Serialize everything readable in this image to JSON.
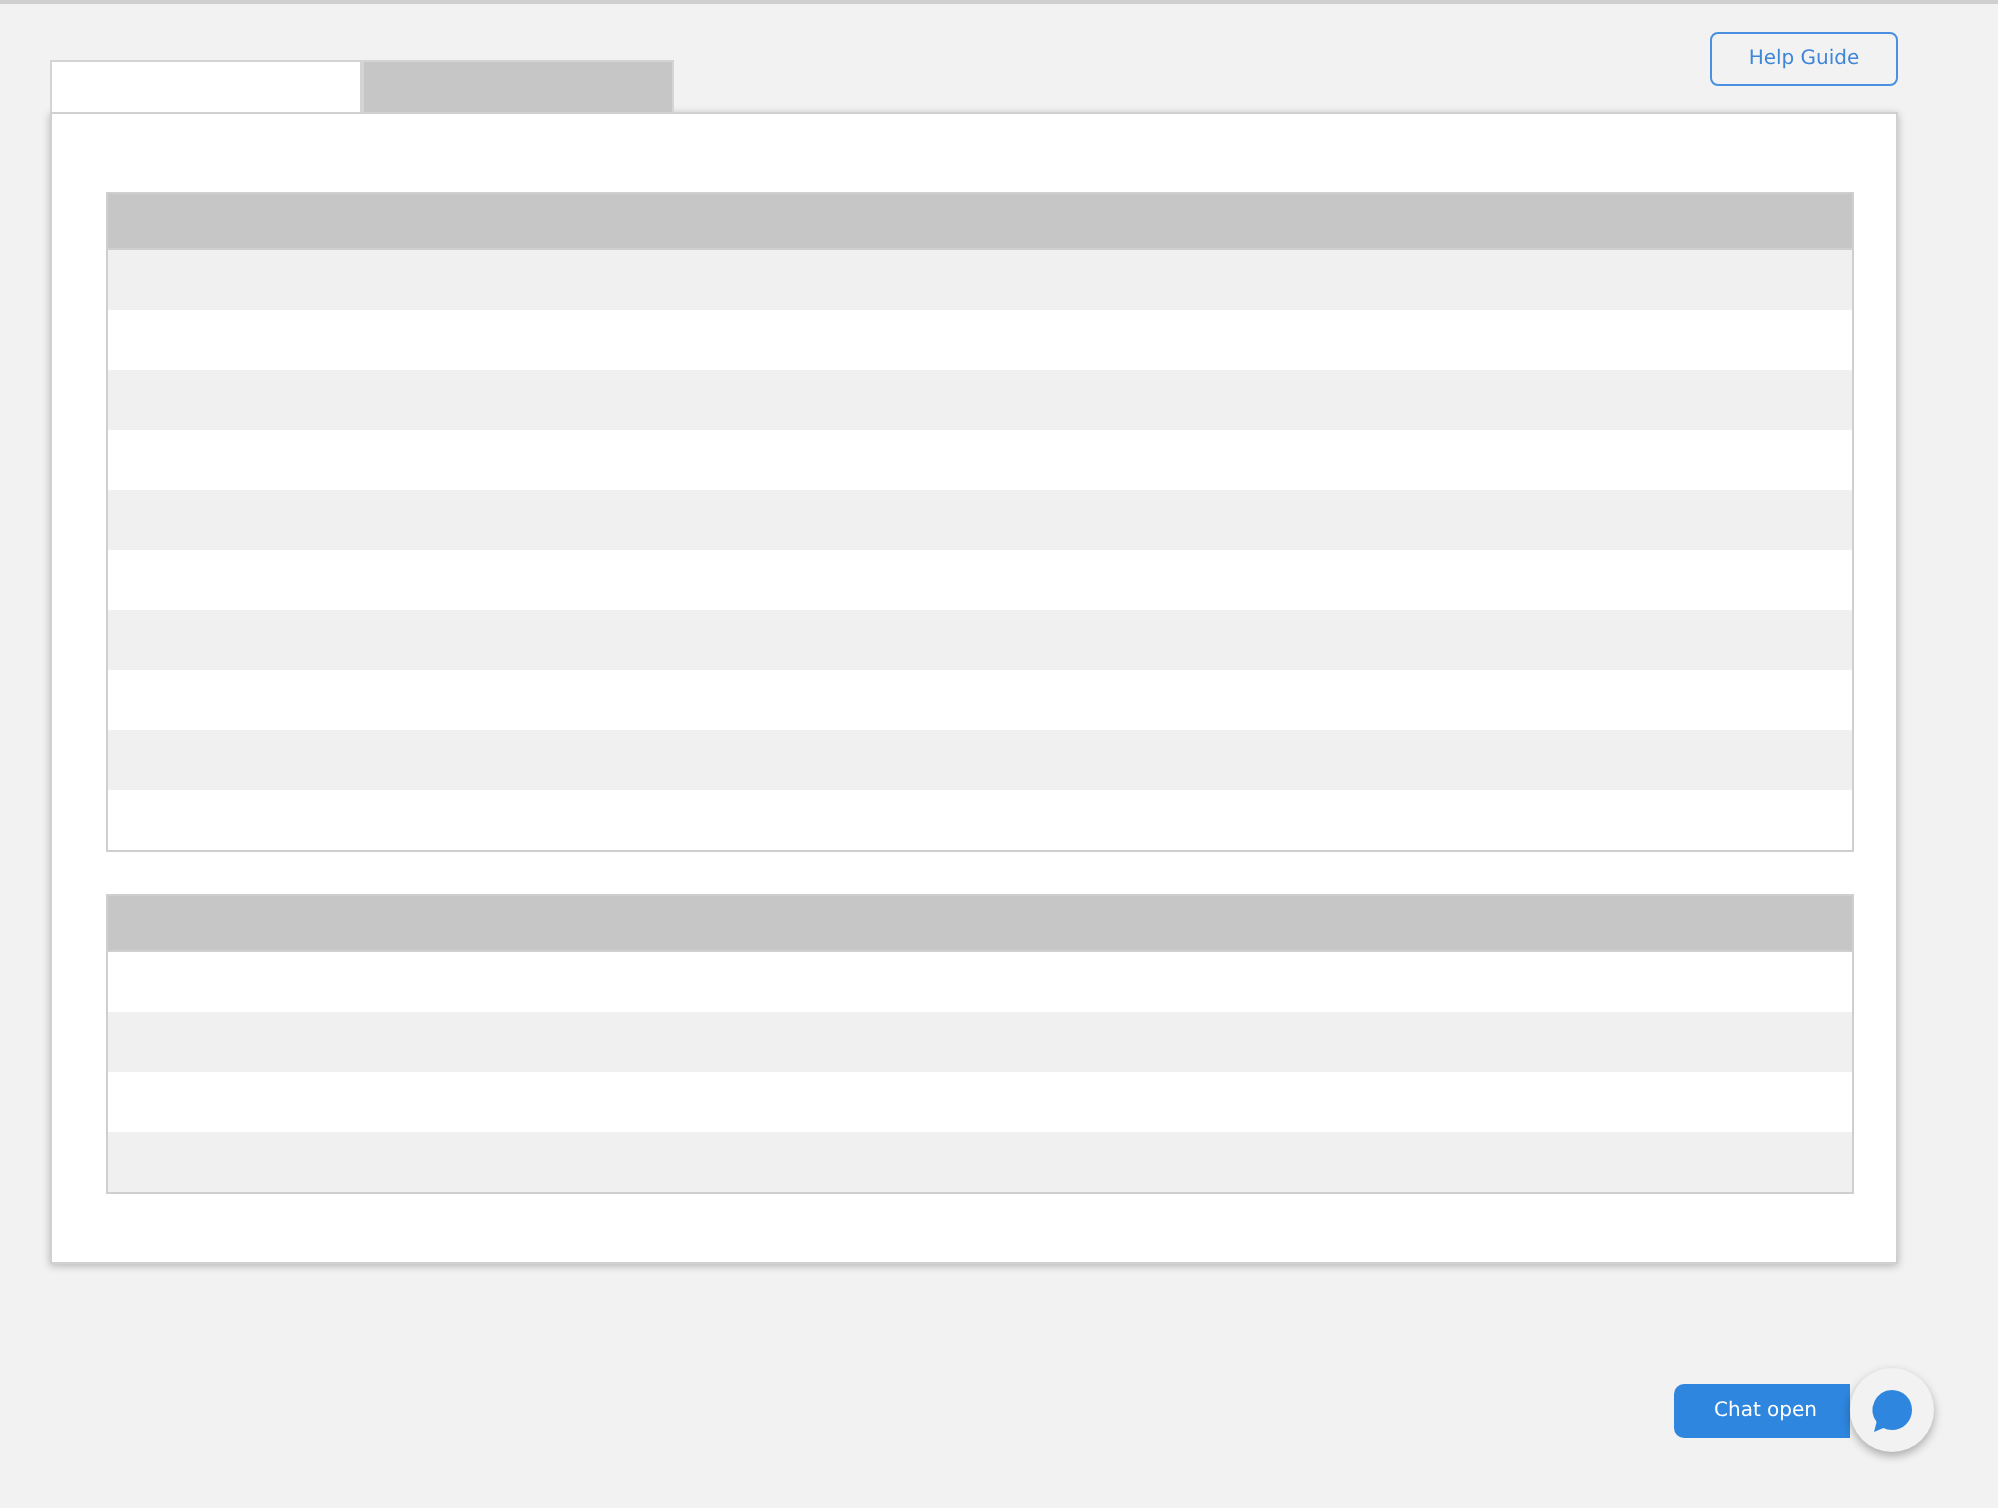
{
  "tabs": [
    {
      "selected": true
    },
    {
      "selected": false
    }
  ],
  "help_button": {
    "label": "Help Guide"
  },
  "tables": [
    {
      "rows": [
        {
          "kind": "shaded"
        },
        {
          "kind": "plain"
        },
        {
          "kind": "shaded"
        },
        {
          "kind": "plain"
        },
        {
          "kind": "shaded"
        },
        {
          "kind": "plain"
        },
        {
          "kind": "shaded"
        },
        {
          "kind": "plain"
        },
        {
          "kind": "shaded"
        },
        {
          "kind": "plain"
        }
      ]
    },
    {
      "rows": [
        {
          "kind": "plain"
        },
        {
          "kind": "shaded"
        },
        {
          "kind": "plain"
        },
        {
          "kind": "shaded"
        }
      ]
    }
  ],
  "chat": {
    "label": "Chat open"
  }
}
